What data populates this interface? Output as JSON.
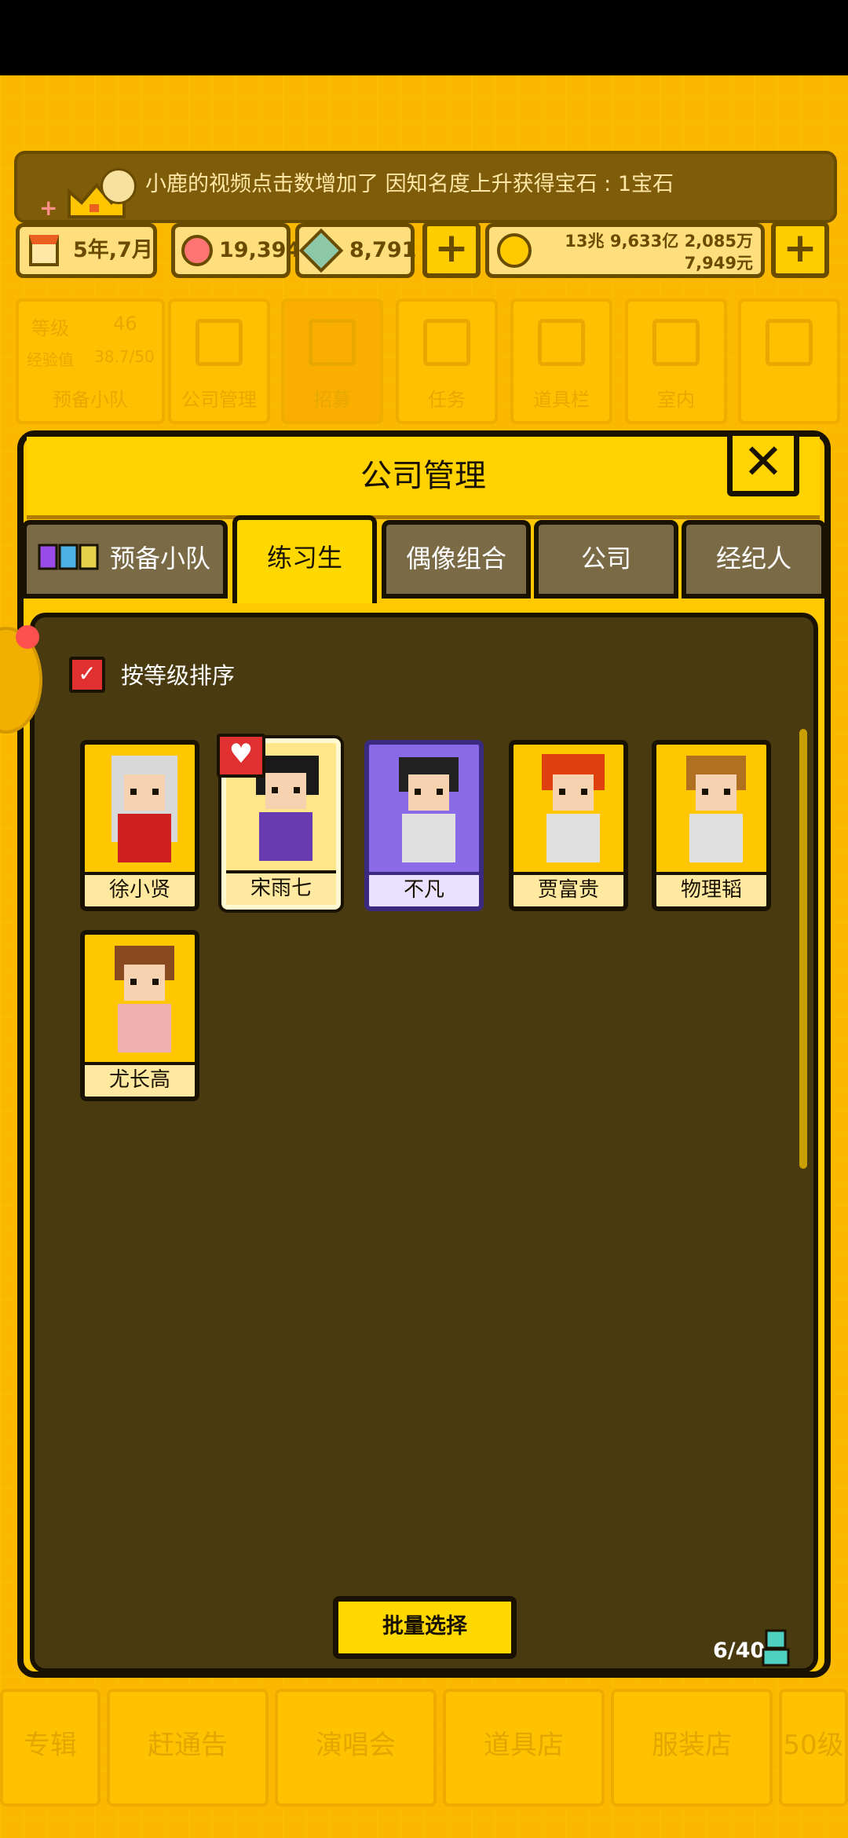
{
  "notification": {
    "text": "小鹿的视频点击数增加了 因知名度上升获得宝石 : 1宝石"
  },
  "resources": {
    "date": "5年,7月",
    "pink_gems": "19,394",
    "blue_gems": "8,791",
    "money_line1": "13兆 9,633亿 2,085万",
    "money_line2": "7,949元"
  },
  "background_nav": {
    "level_label": "等级",
    "level_value": "46",
    "exp_label": "经验值",
    "exp_value": "38.7/50",
    "squad_label": "预备小队",
    "items": [
      {
        "label": "公司管理",
        "icon": "building-icon"
      },
      {
        "label": "招募",
        "icon": "megaphone-icon"
      },
      {
        "label": "任务",
        "icon": "quest-icon"
      },
      {
        "label": "道具栏",
        "icon": "chest-icon"
      },
      {
        "label": "室内",
        "icon": "paint-roller-icon"
      }
    ],
    "bottom": [
      "专辑",
      "赶通告",
      "演唱会",
      "道具店",
      "服装店",
      "50级"
    ]
  },
  "dialog": {
    "title": "公司管理",
    "tabs": [
      {
        "label": "预备小队",
        "active": false
      },
      {
        "label": "练习生",
        "active": true
      },
      {
        "label": "偶像组合",
        "active": false
      },
      {
        "label": "公司",
        "active": false
      },
      {
        "label": "经纪人",
        "active": false
      }
    ],
    "sort_label": "按等级排序",
    "trainees": [
      {
        "name": "徐小贤",
        "hair": "#d8d8d8",
        "outfit": "#d02020"
      },
      {
        "name": "宋雨七",
        "hair": "#1a1a1a",
        "outfit": "#6a3ab0"
      },
      {
        "name": "不凡",
        "hair": "#222222",
        "outfit": "#e0e0e0"
      },
      {
        "name": "贾富贵",
        "hair": "#e04010",
        "outfit": "#e0e0e0"
      },
      {
        "name": "物理韬",
        "hair": "#b07020",
        "outfit": "#e0e0e0"
      },
      {
        "name": "尤长高",
        "hair": "#8a4a20",
        "outfit": "#f0b0b0"
      }
    ],
    "batch_label": "批量选择",
    "count": "6/40",
    "heart_glyph": "♥"
  }
}
